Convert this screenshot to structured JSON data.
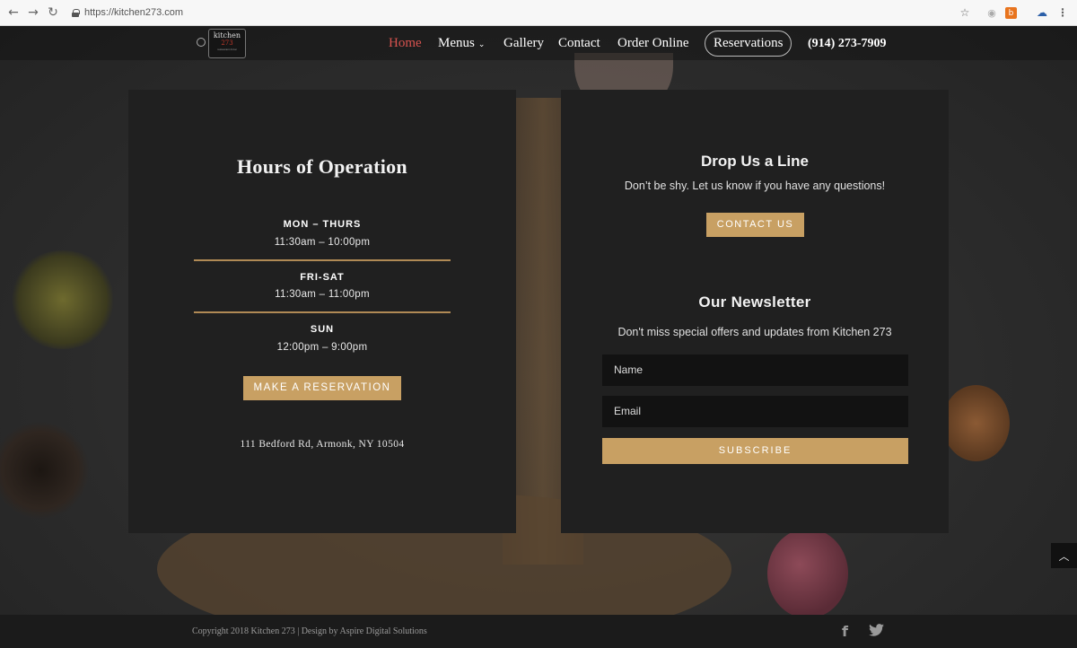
{
  "browser": {
    "url": "https://kitchen273.com",
    "icons": [
      "back-icon",
      "forward-icon",
      "reload-icon",
      "star-icon",
      "extension-icon",
      "extension-orange-icon",
      "cloud-icon",
      "menu-dots-icon"
    ]
  },
  "header": {
    "logo": {
      "line1": "kitchen",
      "line2": "273",
      "line3": "restaurant & bar"
    },
    "nav": {
      "home": "Home",
      "menus": "Menus",
      "gallery": "Gallery",
      "contact": "Contact",
      "order": "Order Online",
      "reservations": "Reservations",
      "phone": "(914) 273-7909"
    },
    "accent_color": "#d9534f"
  },
  "hours": {
    "title": "Hours of Operation",
    "entries": [
      {
        "day": "MON – THURS",
        "time": "11:30am – 10:00pm"
      },
      {
        "day": "FRI-SAT",
        "time": "11:30am – 11:00pm"
      },
      {
        "day": "SUN",
        "time": "12:00pm – 9:00pm"
      }
    ],
    "reserve_button": "MAKE A RESERVATION",
    "address": "111 Bedford Rd, Armonk, NY 10504"
  },
  "contact": {
    "title": "Drop Us a Line",
    "subtitle": "Don’t be shy. Let us know if you have any questions!",
    "button": "CONTACT US"
  },
  "newsletter": {
    "title": "Our Newsletter",
    "subtitle": "Don't miss special offers and updates from Kitchen 273",
    "name_placeholder": "Name",
    "email_placeholder": "Email",
    "button": "SUBSCRIBE"
  },
  "footer": {
    "copyright": "Copyright 2018 Kitchen 273 | Design by Aspire Digital Solutions",
    "social": [
      "facebook-icon",
      "twitter-icon"
    ]
  },
  "colors": {
    "gold": "#c8a063",
    "panel": "#202020"
  }
}
